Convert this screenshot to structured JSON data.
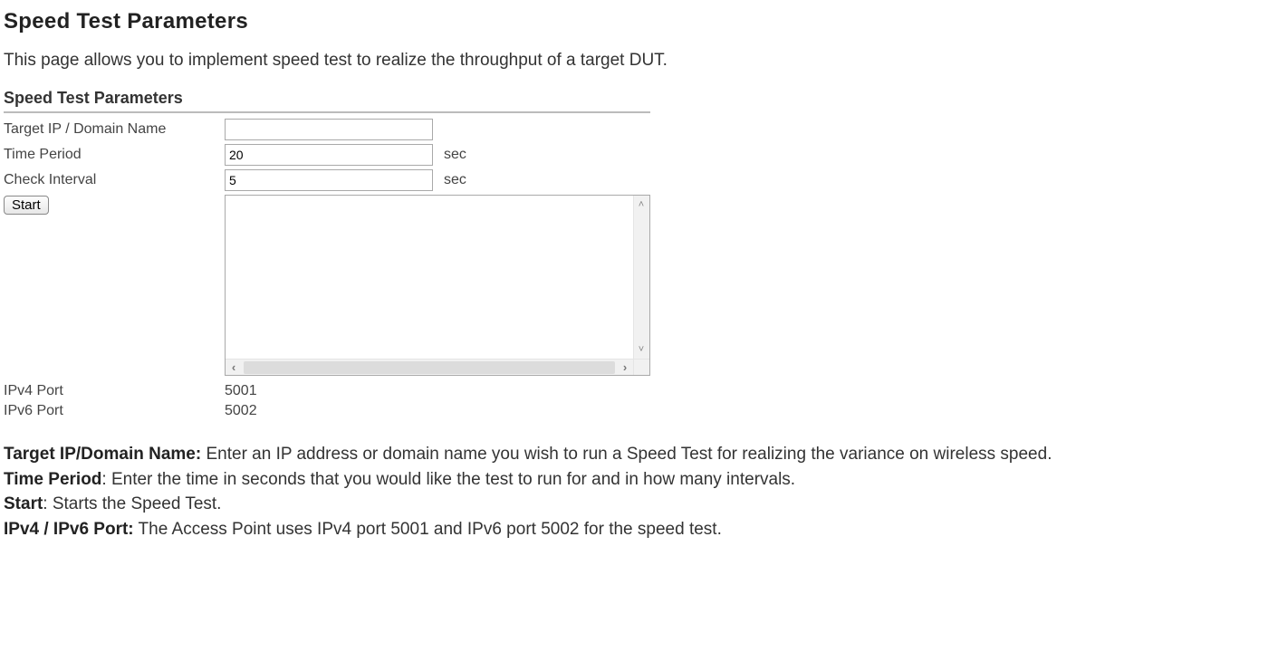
{
  "heading": "Speed Test Parameters",
  "intro": "This page allows you to implement speed test to realize the throughput of a target DUT.",
  "panel": {
    "title": "Speed Test Parameters",
    "rows": {
      "target": {
        "label": "Target IP / Domain Name",
        "value": ""
      },
      "time_period": {
        "label": "Time Period",
        "value": "20",
        "unit": "sec"
      },
      "check_interval": {
        "label": "Check Interval",
        "value": "5",
        "unit": "sec"
      },
      "start_label": "Start",
      "ipv4": {
        "label": "IPv4 Port",
        "value": "5001"
      },
      "ipv6": {
        "label": "IPv6 Port",
        "value": "5002"
      }
    }
  },
  "defs": {
    "target_label": "Target IP/Domain Name:",
    "target_text": " Enter an IP address or domain name you wish to run a Speed Test for realizing the variance on wireless speed.",
    "time_label": "Time Period",
    "time_text": ": Enter the time in seconds that you would like the test to run for and in how many intervals.",
    "start_label": "Start",
    "start_text": ": Starts the Speed Test.",
    "port_label": "IPv4 / IPv6 Port:",
    "port_text": " The Access Point uses IPv4 port 5001 and IPv6 port 5002 for the speed test."
  }
}
